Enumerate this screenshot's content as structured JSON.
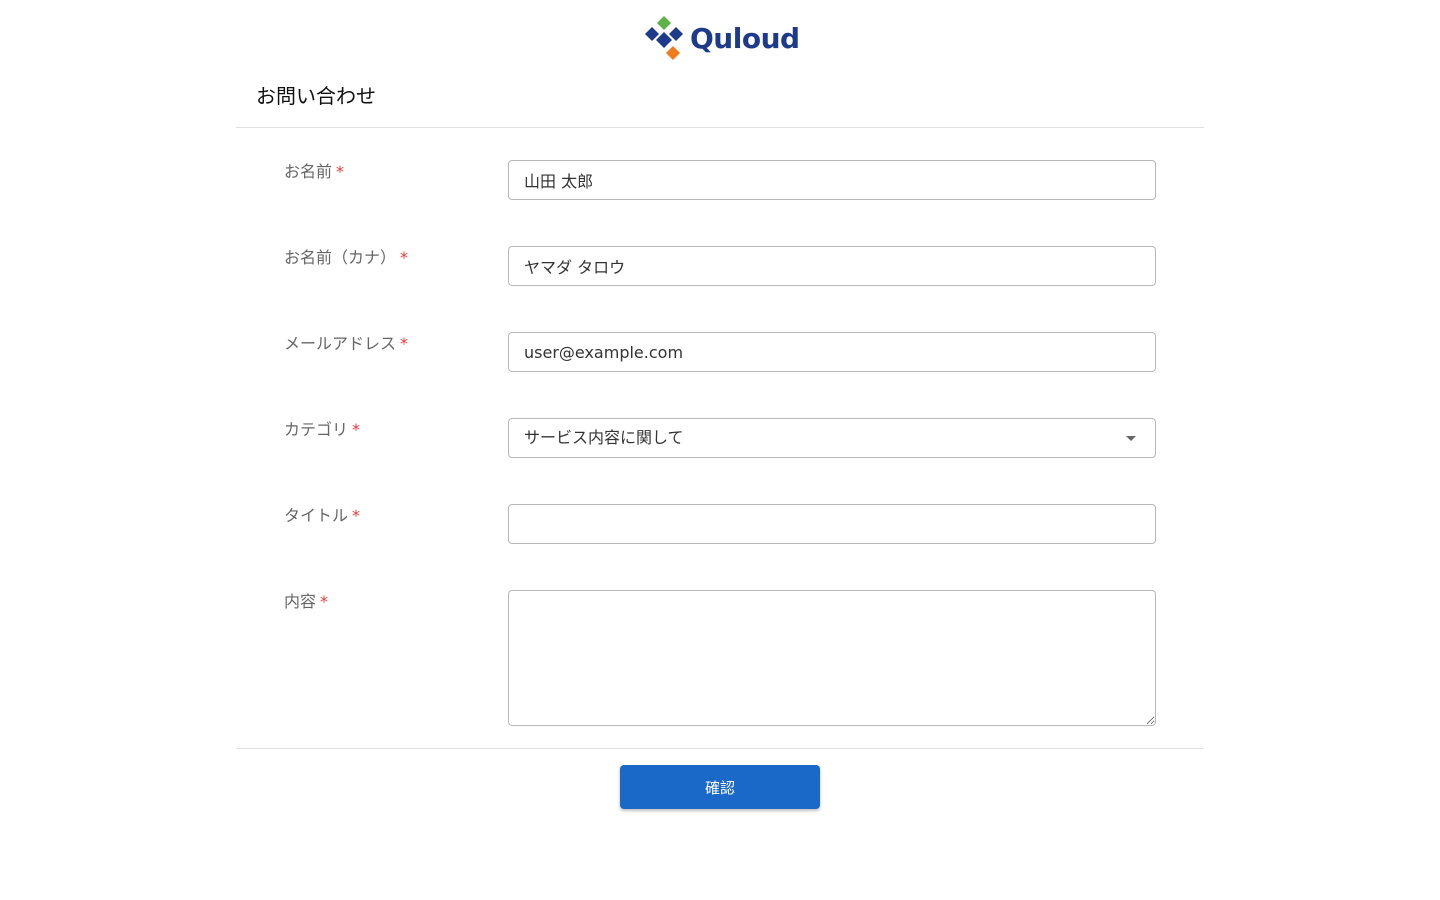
{
  "brand": {
    "name": "Quloud",
    "logo_icon": "diamond-cluster-logo",
    "colors": {
      "navy": "#1e3a8a",
      "green": "#5cb247",
      "orange": "#f07c1b"
    }
  },
  "form": {
    "title": "お問い合わせ",
    "required_mark": "*",
    "fields": {
      "name": {
        "label": "お名前",
        "value": "山田 太郎"
      },
      "kana": {
        "label": "お名前（カナ）",
        "value": "ヤマダ タロウ"
      },
      "email": {
        "label": "メールアドレス",
        "value": "user@example.com"
      },
      "category": {
        "label": "カテゴリ",
        "value": "サービス内容に関して"
      },
      "title": {
        "label": "タイトル",
        "value": ""
      },
      "content": {
        "label": "内容",
        "value": ""
      }
    },
    "confirm_label": "確認",
    "accent_color": "#1a68c7",
    "required_color": "#e53935"
  }
}
